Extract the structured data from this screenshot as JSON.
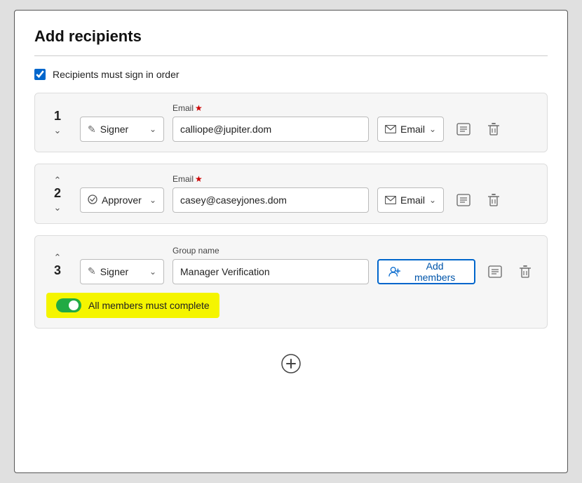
{
  "modal": {
    "title": "Add recipients",
    "divider": true
  },
  "order_checkbox": {
    "checked": true,
    "label": "Recipients must sign in order"
  },
  "recipients": [
    {
      "step": "1",
      "chevron_up": "∧",
      "chevron_down": "∨",
      "show_up": false,
      "show_down": true,
      "role": "Signer",
      "field_label": "Email",
      "required": true,
      "email": "calliope@jupiter.dom",
      "delivery": "Email",
      "type": "email"
    },
    {
      "step": "2",
      "chevron_up": "∧",
      "chevron_down": "∨",
      "show_up": true,
      "show_down": true,
      "role": "Approver",
      "field_label": "Email",
      "required": true,
      "email": "casey@caseyjones.dom",
      "delivery": "Email",
      "type": "email"
    },
    {
      "step": "3",
      "chevron_up": "∧",
      "show_up": true,
      "show_down": false,
      "role": "Signer",
      "field_label": "Group name",
      "required": false,
      "group_name": "Manager Verification",
      "add_members_label": "Add members",
      "toggle_label": "All members must complete",
      "toggle_on": true,
      "type": "group"
    }
  ],
  "add_button": {
    "icon": "⊕",
    "label": "Add recipient"
  },
  "icons": {
    "signer_icon": "✏",
    "approver_icon": "✓",
    "envelope": "✉",
    "more": "⊟",
    "delete": "🗑",
    "group": "👥",
    "chevron_down": "∨"
  }
}
